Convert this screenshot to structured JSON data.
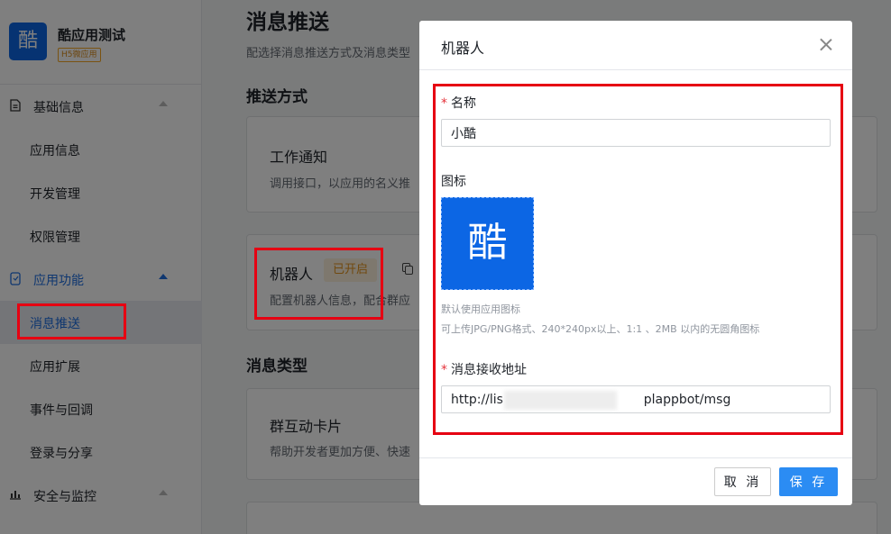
{
  "app": {
    "logo_char": "酷",
    "name": "酷应用测试",
    "tag": "H5微应用"
  },
  "sidebar": {
    "groups": [
      {
        "label": "基础信息",
        "icon": "document-icon"
      },
      {
        "label": "应用功能",
        "icon": "phone-icon"
      },
      {
        "label": "安全与监控",
        "icon": "bar-chart-icon"
      }
    ],
    "items": [
      "应用信息",
      "开发管理",
      "权限管理",
      "消息推送",
      "应用扩展",
      "事件与回调",
      "登录与分享"
    ]
  },
  "main": {
    "title": "消息推送",
    "description": "配选择消息推送方式及消息类型",
    "push_section": "推送方式",
    "work_notice": {
      "title": "工作通知",
      "desc": "调用接口，以应用的名义推"
    },
    "robot": {
      "title": "机器人",
      "badge": "已开启",
      "desc": "配置机器人信息，配合群应"
    },
    "type_section": "消息类型",
    "card_type": {
      "title": "群互动卡片",
      "desc": "帮助开发者更加方便、快速"
    }
  },
  "dialog": {
    "title": "机器人",
    "name_label": "名称",
    "name_value": "小酷",
    "icon_label": "图标",
    "icon_char": "酷",
    "hint_1": "默认使用应用图标",
    "hint_2": "可上传JPG/PNG格式、240*240px以上、1:1 、2MB 以内的无圆角图标",
    "url_label": "消息接收地址",
    "url_value": "http://lis                                   plappbot/msg",
    "cancel_label": "取 消",
    "save_label": "保 存"
  },
  "colors": {
    "accent": "#2b8cf3",
    "brand": "#0c66e4",
    "highlight": "#e60012",
    "badge": "#e3921c"
  }
}
